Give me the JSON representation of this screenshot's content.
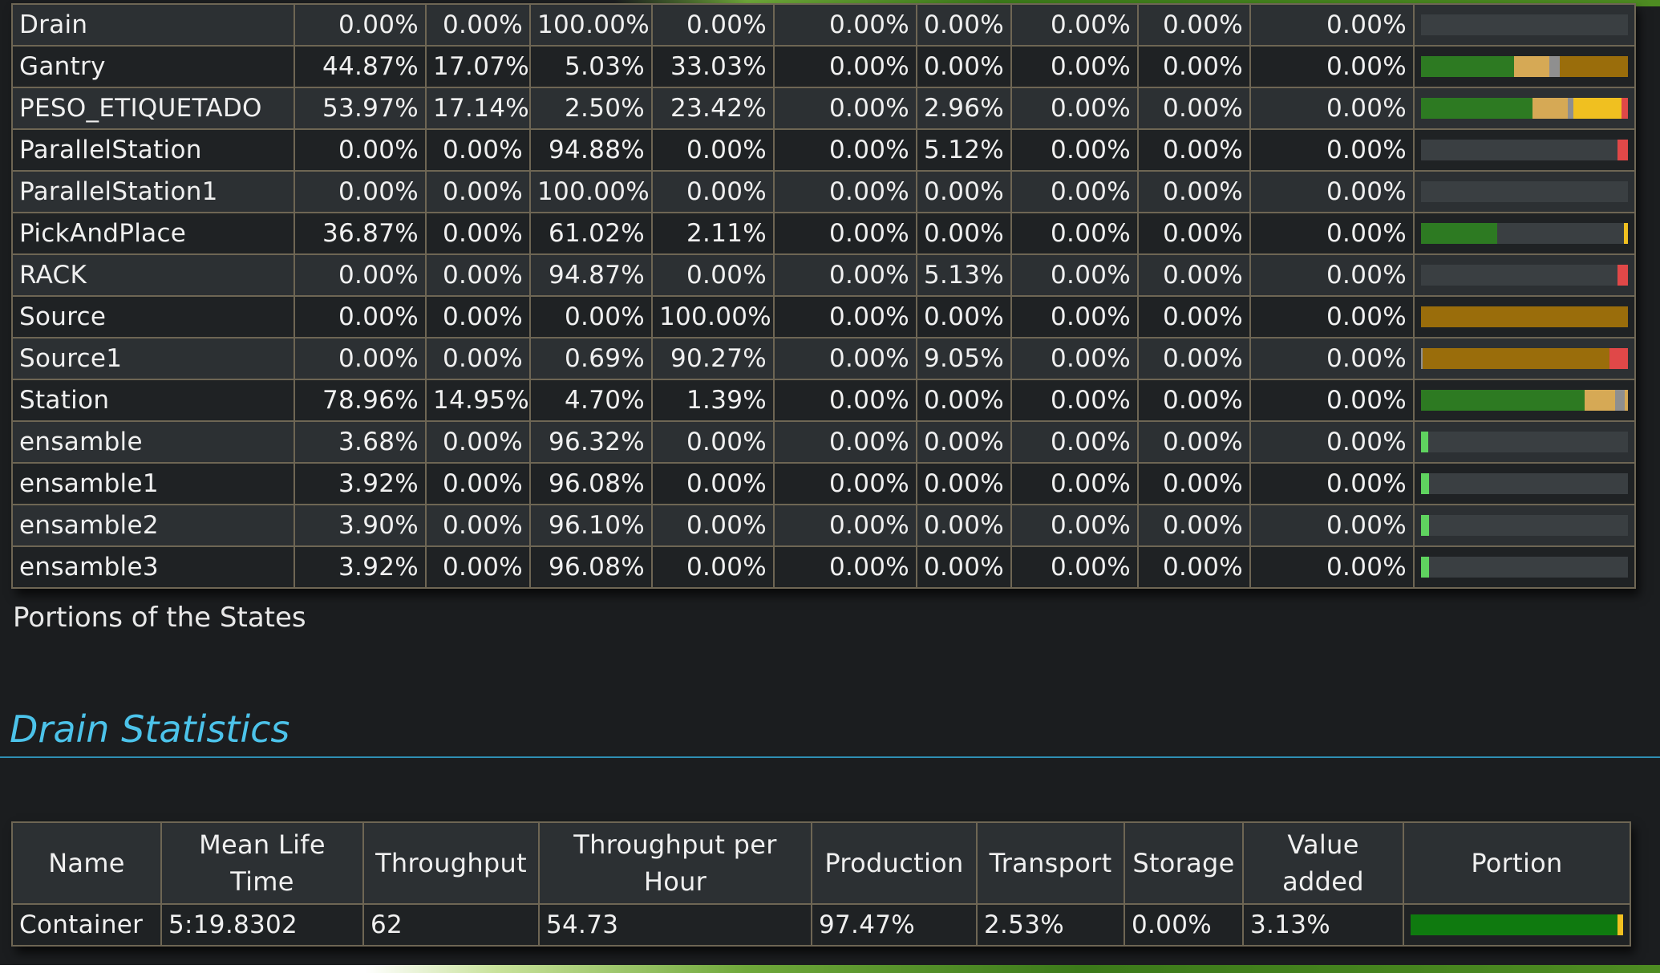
{
  "state_colors": {
    "working": "#2d7a22",
    "setup": "#d6a955",
    "waiting": "#8f8f8f",
    "blocked": "#9a6d0b",
    "paused": "#f0c020",
    "failed": "#e04848",
    "value_added": "#5fd35f",
    "empty": "#3a3f42"
  },
  "states_table": {
    "rows": [
      {
        "name": "Drain",
        "values": [
          "0.00%",
          "0.00%",
          "100.00%",
          "0.00%",
          "0.00%",
          "0.00%",
          "0.00%",
          "0.00%",
          "0.00%"
        ],
        "portion": [
          [
            "working",
            0
          ],
          [
            "setup",
            0
          ],
          [
            "waiting",
            0
          ],
          [
            "blocked",
            0
          ],
          [
            "paused",
            0
          ],
          [
            "failed",
            0
          ]
        ]
      },
      {
        "name": "Gantry",
        "values": [
          "44.87%",
          "17.07%",
          "5.03%",
          "33.03%",
          "0.00%",
          "0.00%",
          "0.00%",
          "0.00%",
          "0.00%"
        ],
        "portion": [
          [
            "working",
            44.87
          ],
          [
            "setup",
            17.07
          ],
          [
            "waiting",
            5.03
          ],
          [
            "blocked",
            33.03
          ]
        ]
      },
      {
        "name": "PESO_ETIQUETADO",
        "values": [
          "53.97%",
          "17.14%",
          "2.50%",
          "23.42%",
          "0.00%",
          "2.96%",
          "0.00%",
          "0.00%",
          "0.00%"
        ],
        "portion": [
          [
            "working",
            53.97
          ],
          [
            "setup",
            17.14
          ],
          [
            "waiting",
            2.5
          ],
          [
            "paused",
            23.42
          ],
          [
            "failed",
            2.96
          ]
        ]
      },
      {
        "name": "ParallelStation",
        "values": [
          "0.00%",
          "0.00%",
          "94.88%",
          "0.00%",
          "0.00%",
          "5.12%",
          "0.00%",
          "0.00%",
          "0.00%"
        ],
        "portion": [
          [
            "empty",
            94.88
          ],
          [
            "failed",
            5.12
          ]
        ]
      },
      {
        "name": "ParallelStation1",
        "values": [
          "0.00%",
          "0.00%",
          "100.00%",
          "0.00%",
          "0.00%",
          "0.00%",
          "0.00%",
          "0.00%",
          "0.00%"
        ],
        "portion": [
          [
            "empty",
            100
          ]
        ]
      },
      {
        "name": "PickAndPlace",
        "values": [
          "36.87%",
          "0.00%",
          "61.02%",
          "2.11%",
          "0.00%",
          "0.00%",
          "0.00%",
          "0.00%",
          "0.00%"
        ],
        "portion": [
          [
            "working",
            36.87
          ],
          [
            "empty",
            61.02
          ],
          [
            "paused",
            2.11
          ]
        ]
      },
      {
        "name": "RACK",
        "values": [
          "0.00%",
          "0.00%",
          "94.87%",
          "0.00%",
          "0.00%",
          "5.13%",
          "0.00%",
          "0.00%",
          "0.00%"
        ],
        "portion": [
          [
            "empty",
            94.87
          ],
          [
            "failed",
            5.13
          ]
        ]
      },
      {
        "name": "Source",
        "values": [
          "0.00%",
          "0.00%",
          "0.00%",
          "100.00%",
          "0.00%",
          "0.00%",
          "0.00%",
          "0.00%",
          "0.00%"
        ],
        "portion": [
          [
            "blocked",
            100
          ]
        ]
      },
      {
        "name": "Source1",
        "values": [
          "0.00%",
          "0.00%",
          "0.69%",
          "90.27%",
          "0.00%",
          "9.05%",
          "0.00%",
          "0.00%",
          "0.00%"
        ],
        "portion": [
          [
            "waiting",
            0.69
          ],
          [
            "blocked",
            90.27
          ],
          [
            "failed",
            9.05
          ]
        ]
      },
      {
        "name": "Station",
        "values": [
          "78.96%",
          "14.95%",
          "4.70%",
          "1.39%",
          "0.00%",
          "0.00%",
          "0.00%",
          "0.00%",
          "0.00%"
        ],
        "portion": [
          [
            "working",
            78.96
          ],
          [
            "setup",
            14.95
          ],
          [
            "waiting",
            4.7
          ],
          [
            "setup",
            1.39
          ]
        ]
      },
      {
        "name": "ensamble",
        "values": [
          "3.68%",
          "0.00%",
          "96.32%",
          "0.00%",
          "0.00%",
          "0.00%",
          "0.00%",
          "0.00%",
          "0.00%"
        ],
        "portion": [
          [
            "value_added",
            3.68
          ],
          [
            "empty",
            96.32
          ]
        ]
      },
      {
        "name": "ensamble1",
        "values": [
          "3.92%",
          "0.00%",
          "96.08%",
          "0.00%",
          "0.00%",
          "0.00%",
          "0.00%",
          "0.00%",
          "0.00%"
        ],
        "portion": [
          [
            "value_added",
            3.92
          ],
          [
            "empty",
            96.08
          ]
        ]
      },
      {
        "name": "ensamble2",
        "values": [
          "3.90%",
          "0.00%",
          "96.10%",
          "0.00%",
          "0.00%",
          "0.00%",
          "0.00%",
          "0.00%",
          "0.00%"
        ],
        "portion": [
          [
            "value_added",
            3.9
          ],
          [
            "empty",
            96.1
          ]
        ]
      },
      {
        "name": "ensamble3",
        "values": [
          "3.92%",
          "0.00%",
          "96.08%",
          "0.00%",
          "0.00%",
          "0.00%",
          "0.00%",
          "0.00%",
          "0.00%"
        ],
        "portion": [
          [
            "value_added",
            3.92
          ],
          [
            "empty",
            96.08
          ]
        ]
      }
    ]
  },
  "caption": "Portions of the States",
  "drain_section": {
    "title": "Drain Statistics",
    "headers": [
      "Name",
      "Mean Life Time",
      "Throughput",
      "Throughput per Hour",
      "Production",
      "Transport",
      "Storage",
      "Value added",
      "Portion"
    ],
    "rows": [
      {
        "name": "Container",
        "mean_life_time": "5:19.8302",
        "throughput": "62",
        "throughput_per_hour": "54.73",
        "production": "97.47%",
        "transport": "2.53%",
        "storage": "0.00%",
        "value_added": "3.13%",
        "portion": [
          [
            "production",
            97.47
          ],
          [
            "transport",
            2.53
          ]
        ]
      }
    ],
    "portion_colors": {
      "production": "#0f7a0f",
      "transport": "#f0c020"
    }
  }
}
